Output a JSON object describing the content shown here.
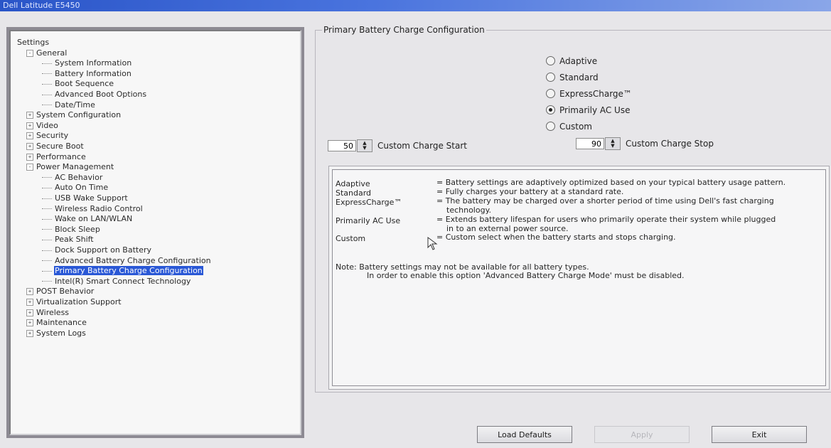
{
  "window": {
    "title": "Dell Latitude E5450"
  },
  "tree": {
    "items": [
      {
        "label": "Settings",
        "level": 0,
        "expander": ""
      },
      {
        "label": "General",
        "level": 1,
        "expander": "-"
      },
      {
        "label": "System Information",
        "level": 2,
        "expander": ""
      },
      {
        "label": "Battery Information",
        "level": 2,
        "expander": ""
      },
      {
        "label": "Boot Sequence",
        "level": 2,
        "expander": ""
      },
      {
        "label": "Advanced Boot Options",
        "level": 2,
        "expander": ""
      },
      {
        "label": "Date/Time",
        "level": 2,
        "expander": ""
      },
      {
        "label": "System Configuration",
        "level": 1,
        "expander": "+"
      },
      {
        "label": "Video",
        "level": 1,
        "expander": "+"
      },
      {
        "label": "Security",
        "level": 1,
        "expander": "+"
      },
      {
        "label": "Secure Boot",
        "level": 1,
        "expander": "+"
      },
      {
        "label": "Performance",
        "level": 1,
        "expander": "+"
      },
      {
        "label": "Power Management",
        "level": 1,
        "expander": "-"
      },
      {
        "label": "AC Behavior",
        "level": 2,
        "expander": ""
      },
      {
        "label": "Auto On Time",
        "level": 2,
        "expander": ""
      },
      {
        "label": "USB Wake Support",
        "level": 2,
        "expander": ""
      },
      {
        "label": "Wireless Radio Control",
        "level": 2,
        "expander": ""
      },
      {
        "label": "Wake on LAN/WLAN",
        "level": 2,
        "expander": ""
      },
      {
        "label": "Block Sleep",
        "level": 2,
        "expander": ""
      },
      {
        "label": "Peak Shift",
        "level": 2,
        "expander": ""
      },
      {
        "label": "Dock Support on Battery",
        "level": 2,
        "expander": ""
      },
      {
        "label": "Advanced Battery Charge Configuration",
        "level": 2,
        "expander": ""
      },
      {
        "label": "Primary Battery Charge Configuration",
        "level": 2,
        "expander": "",
        "selected": true
      },
      {
        "label": "Intel(R) Smart Connect Technology",
        "level": 2,
        "expander": ""
      },
      {
        "label": "POST Behavior",
        "level": 1,
        "expander": "+"
      },
      {
        "label": "Virtualization Support",
        "level": 1,
        "expander": "+"
      },
      {
        "label": "Wireless",
        "level": 1,
        "expander": "+"
      },
      {
        "label": "Maintenance",
        "level": 1,
        "expander": "+"
      },
      {
        "label": "System Logs",
        "level": 1,
        "expander": "+"
      }
    ]
  },
  "group": {
    "title": "Primary Battery Charge Configuration"
  },
  "radios": [
    {
      "label": "Adaptive",
      "checked": false
    },
    {
      "label": "Standard",
      "checked": false
    },
    {
      "label": "ExpressCharge™",
      "checked": false
    },
    {
      "label": "Primarily AC Use",
      "checked": true
    },
    {
      "label": "Custom",
      "checked": false
    }
  ],
  "custom_start": {
    "value": "50",
    "label": "Custom Charge Start"
  },
  "custom_stop": {
    "value": "90",
    "label": "Custom Charge Stop"
  },
  "descriptions": [
    {
      "term": "Adaptive",
      "text": "= Battery settings are adaptively optimized based on your typical battery usage pattern."
    },
    {
      "term": "Standard",
      "text": "= Fully charges your battery at a standard rate."
    },
    {
      "term": "ExpressCharge™",
      "text": "= The battery may be charged over a shorter period of time using Dell's fast charging",
      "text2": "technology."
    },
    {
      "term": "Primarily AC Use",
      "text": "= Extends battery lifespan for users who primarily operate their system while plugged",
      "text2": "in to an external power source."
    },
    {
      "term": "Custom",
      "text": "= Custom select when the battery starts and stops charging."
    }
  ],
  "note": {
    "line1": "Note:  Battery settings may not be available for all battery types.",
    "line2": "In order to enable this option 'Advanced Battery Charge Mode' must be disabled."
  },
  "buttons": {
    "load_defaults": "Load Defaults",
    "apply": "Apply",
    "exit": "Exit"
  }
}
